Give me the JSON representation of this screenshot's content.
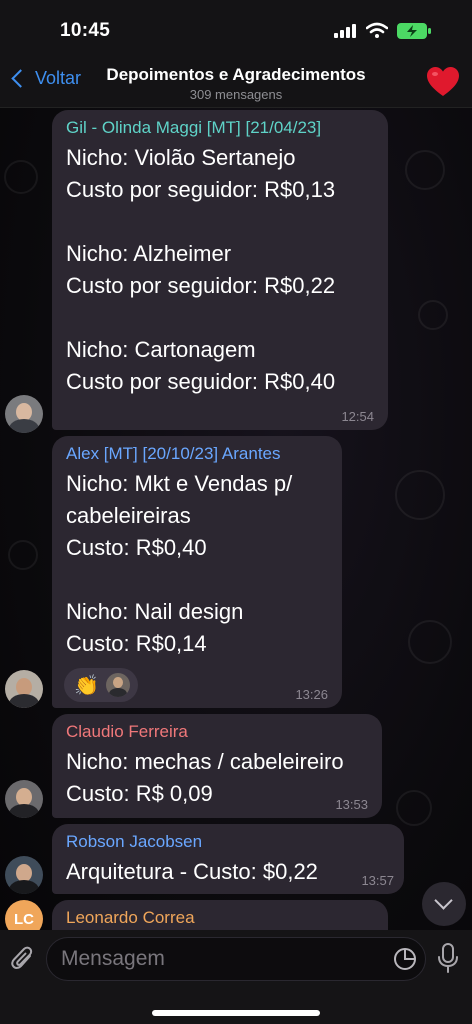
{
  "status_bar": {
    "time": "10:45"
  },
  "header": {
    "back_label": "Voltar",
    "title": "Depoimentos e Agradecimentos",
    "subtitle": "309 mensagens"
  },
  "messages": [
    {
      "sender": "Gil - Olinda Maggi [MT] [21/04/23]",
      "sender_color": "#5fd3c8",
      "text": "Nicho: Violão Sertanejo\nCusto por seguidor: R$0,13\n\nNicho: Alzheimer\nCusto por seguidor: R$0,22\n\nNicho: Cartonagem\nCusto por seguidor: R$0,40",
      "time": "12:54"
    },
    {
      "sender": "Alex [MT] [20/10/23] Arantes",
      "sender_color": "#6aa7ff",
      "text": "Nicho: Mkt e Vendas p/\ncabeleireiras\nCusto: R$0,40\n\nNicho: Nail design\nCusto: R$0,14",
      "time": "13:26",
      "reaction": "👏"
    },
    {
      "sender": "Claudio Ferreira",
      "sender_color": "#f0787a",
      "text": "Nicho: mechas / cabeleireiro\nCusto: R$ 0,09",
      "time": "13:53"
    },
    {
      "sender": "Robson Jacobsen",
      "sender_color": "#6aa7ff",
      "text": "Arquitetura - Custo: $0,22",
      "time": "13:57"
    },
    {
      "sender": "Leonardo Correa",
      "sender_color": "#f0a65a",
      "avatar_initials": "LC"
    }
  ],
  "input": {
    "placeholder": "Mensagem"
  },
  "colors": {
    "accent": "#3e8ff0",
    "bubble": "#2c2731",
    "battery": "#4cd964",
    "heart": "#e0192d"
  }
}
